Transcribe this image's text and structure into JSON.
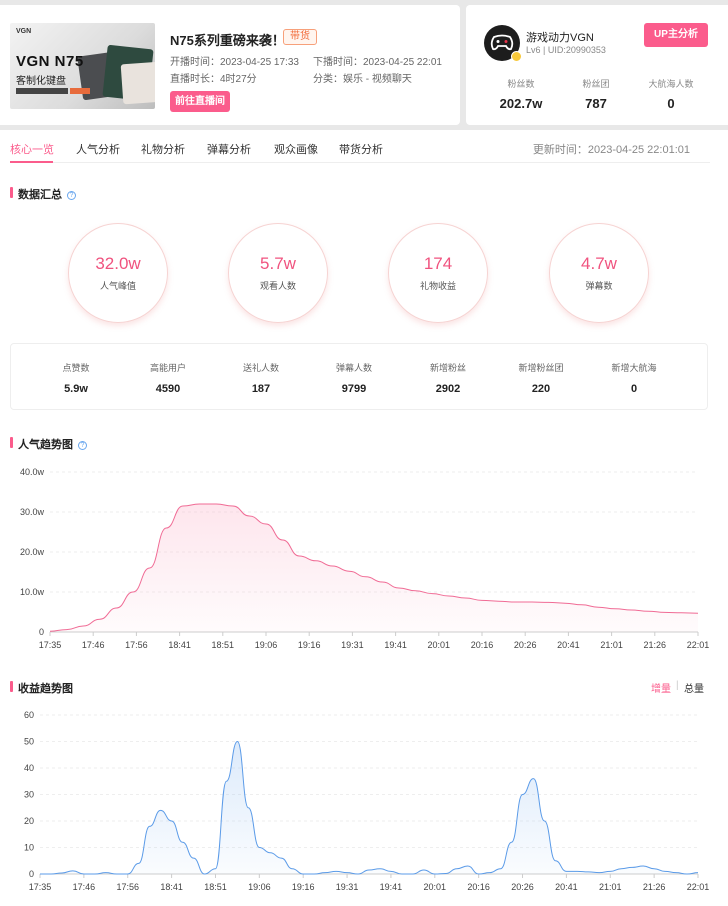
{
  "live": {
    "thumb_brand": "VGN",
    "thumb_model": "VGN N75",
    "thumb_slogan": "客制化键盘",
    "title": "N75系列重磅来袭！",
    "tag": "带货",
    "start_time": "开播时间：2023-04-25 17:33",
    "end_time": "下播时间：2023-04-25 22:01",
    "duration": "直播时长：4时27分",
    "category": "分类：娱乐 - 视频聊天",
    "goto_label": "前往直播间"
  },
  "up": {
    "name": "游戏动力VGN",
    "sub": "Lv6 | UID:20990353",
    "analysis_label": "UP主分析",
    "stats": [
      {
        "label": "粉丝数",
        "value": "202.7w"
      },
      {
        "label": "粉丝团",
        "value": "787"
      },
      {
        "label": "大航海人数",
        "value": "0"
      }
    ]
  },
  "tabs": [
    "核心一览",
    "人气分析",
    "礼物分析",
    "弹幕分析",
    "观众画像",
    "带货分析"
  ],
  "update_time": "更新时间：2023-04-25 22:01:01",
  "summary": {
    "title": "数据汇总",
    "circles": [
      {
        "value": "32.0w",
        "label": "人气峰值"
      },
      {
        "value": "5.7w",
        "label": "观看人数"
      },
      {
        "value": "174",
        "label": "礼物收益"
      },
      {
        "value": "4.7w",
        "label": "弹幕数"
      }
    ],
    "stats": [
      {
        "label": "点赞数",
        "value": "5.9w"
      },
      {
        "label": "高能用户",
        "value": "4590"
      },
      {
        "label": "送礼人数",
        "value": "187"
      },
      {
        "label": "弹幕人数",
        "value": "9799"
      },
      {
        "label": "新增粉丝",
        "value": "2902"
      },
      {
        "label": "新增粉丝团",
        "value": "220"
      },
      {
        "label": "新增大航海",
        "value": "0"
      }
    ]
  },
  "popularity_title": "人气趋势图",
  "income_title": "收益趋势图",
  "income_toggle": {
    "active": "增量",
    "inactive": "总量"
  },
  "colors": {
    "accent": "#fb5c8c",
    "line1": "#f06b95",
    "line2": "#5b9be8"
  },
  "chart_data": [
    {
      "type": "area",
      "title": "人气趋势图",
      "y_ticks": [
        "0",
        "10.0w",
        "20.0w",
        "30.0w",
        "40.0w"
      ],
      "ylim": [
        0,
        40
      ],
      "x_tick_labels": [
        "17:35",
        "17:46",
        "17:56",
        "18:41",
        "18:51",
        "19:06",
        "19:16",
        "19:31",
        "19:41",
        "20:01",
        "20:16",
        "20:26",
        "20:41",
        "21:01",
        "21:26",
        "22:01"
      ],
      "x": [
        0,
        0.5,
        1,
        1.5,
        2,
        2.5,
        3,
        3.3,
        3.6,
        3.9,
        4.1,
        4.3,
        4.6,
        5,
        5.4,
        5.8,
        6.2,
        6.6,
        7,
        7.5,
        8,
        8.5,
        9,
        9.5,
        10,
        10.5,
        11,
        11.5,
        12,
        12.5,
        13,
        13.5,
        14,
        14.5,
        15
      ],
      "values": [
        0.2,
        0.6,
        1.5,
        3.2,
        6,
        10,
        16,
        26,
        31.5,
        32,
        32,
        31.5,
        29,
        27,
        23,
        19,
        17.8,
        16.5,
        15.2,
        13.8,
        12.5,
        11,
        10.3,
        9.6,
        9,
        8.5,
        7.9,
        7.7,
        7.5,
        7.5,
        7.4,
        7.2,
        6.8,
        6.2,
        5.8,
        5.5,
        5.2,
        4.9,
        4.8,
        4.7
      ],
      "grid": true
    },
    {
      "type": "area",
      "title": "收益趋势图",
      "y_ticks": [
        "0",
        "10",
        "20",
        "30",
        "40",
        "50",
        "60"
      ],
      "ylim": [
        0,
        60
      ],
      "x_tick_labels": [
        "17:35",
        "17:46",
        "17:56",
        "18:41",
        "18:51",
        "19:06",
        "19:16",
        "19:31",
        "19:41",
        "20:01",
        "20:16",
        "20:26",
        "20:41",
        "21:01",
        "21:26",
        "22:01"
      ],
      "values": [
        0,
        0,
        0.4,
        1.2,
        0,
        0,
        0.5,
        0,
        0,
        4,
        18,
        24,
        20,
        12,
        6,
        0,
        2,
        35,
        50,
        25,
        10,
        8,
        6,
        2,
        0,
        0,
        0.5,
        1,
        0.5,
        0,
        1.5,
        2,
        1,
        0,
        0,
        1.5,
        0,
        0.2,
        2,
        3,
        0,
        0.5,
        2,
        12,
        30,
        36,
        20,
        5,
        1,
        1,
        0.8,
        0.5,
        1,
        2,
        2.5,
        3,
        2,
        1,
        0.5,
        0,
        0.5
      ]
    }
  ]
}
